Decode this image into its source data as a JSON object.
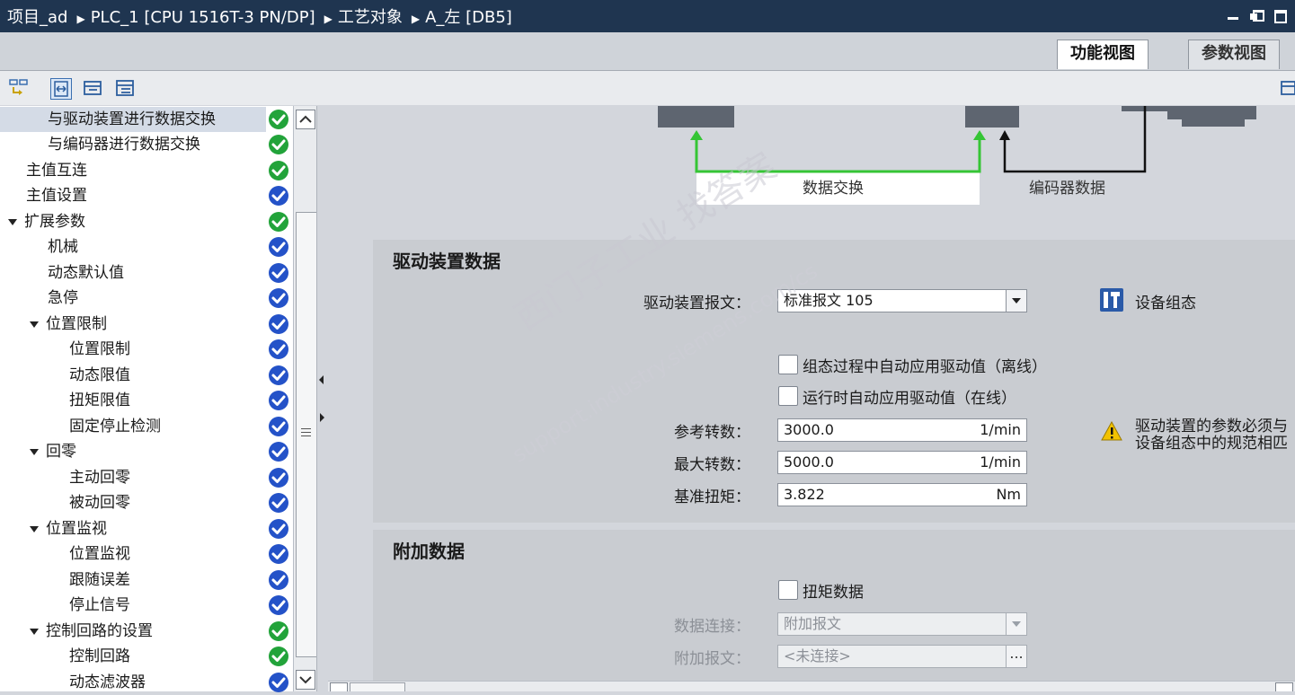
{
  "titlebar": {
    "crumbs": [
      "项目_ad",
      "PLC_1 [CPU 1516T-3 PN/DP]",
      "工艺对象",
      "A_左 [DB5]"
    ]
  },
  "view_tabs": {
    "function_view": "功能视图",
    "param_view": "参数视图"
  },
  "tree": {
    "items": [
      {
        "label": "与驱动装置进行数据交换",
        "status": "ok-green"
      },
      {
        "label": "与编码器进行数据交换",
        "status": "ok-green"
      },
      {
        "label": "主值互连",
        "status": "ok-green"
      },
      {
        "label": "主值设置",
        "status": "ok-blue"
      },
      {
        "label": "扩展参数",
        "status": "ok-green"
      },
      {
        "label": "机械",
        "status": "ok-blue"
      },
      {
        "label": "动态默认值",
        "status": "ok-blue"
      },
      {
        "label": "急停",
        "status": "ok-blue"
      },
      {
        "label": "位置限制",
        "status": "ok-blue"
      },
      {
        "label": "位置限制",
        "status": "ok-blue"
      },
      {
        "label": "动态限值",
        "status": "ok-blue"
      },
      {
        "label": "扭矩限值",
        "status": "ok-blue"
      },
      {
        "label": "固定停止检测",
        "status": "ok-blue"
      },
      {
        "label": "回零",
        "status": "ok-blue"
      },
      {
        "label": "主动回零",
        "status": "ok-blue"
      },
      {
        "label": "被动回零",
        "status": "ok-blue"
      },
      {
        "label": "位置监视",
        "status": "ok-blue"
      },
      {
        "label": "位置监视",
        "status": "ok-blue"
      },
      {
        "label": "跟随误差",
        "status": "ok-blue"
      },
      {
        "label": "停止信号",
        "status": "ok-blue"
      },
      {
        "label": "控制回路的设置",
        "status": "ok-green"
      },
      {
        "label": "控制回路",
        "status": "ok-green"
      },
      {
        "label": "动态滤波器",
        "status": "ok-blue"
      }
    ]
  },
  "diagram": {
    "data_exchange": "数据交换",
    "encoder_data": "编码器数据"
  },
  "drive_section": {
    "title": "驱动装置数据",
    "telegram_label": "驱动装置报文：",
    "telegram_value": "标准报文 105",
    "device_config": "设备组态",
    "auto_offline": "组态过程中自动应用驱动值（离线）",
    "auto_online": "运行时自动应用驱动值（在线）",
    "ref_speed_label": "参考转数：",
    "ref_speed_value": "3000.0",
    "ref_speed_unit": "1/min",
    "max_speed_label": "最大转数：",
    "max_speed_value": "5000.0",
    "max_speed_unit": "1/min",
    "ref_torque_label": "基准扭矩：",
    "ref_torque_value": "3.822",
    "ref_torque_unit": "Nm",
    "warning_line1": "驱动装置的参数必须与",
    "warning_line2": "设备组态中的规范相匹"
  },
  "extra_section": {
    "title": "附加数据",
    "torque_data": "扭矩数据",
    "conn_label": "数据连接：",
    "conn_value": "附加报文",
    "tel_label": "附加报文：",
    "tel_value": "<未连接>",
    "tel_btn": "..."
  },
  "watermark": {
    "line1": "西门子工业 找答案",
    "line2": "support.industry.siemens.com/cs"
  },
  "colors": {
    "ok_green": "#22a33a",
    "ok_blue": "#2452c8",
    "title_bg": "#1f3550",
    "arrow_green": "#35c535"
  }
}
